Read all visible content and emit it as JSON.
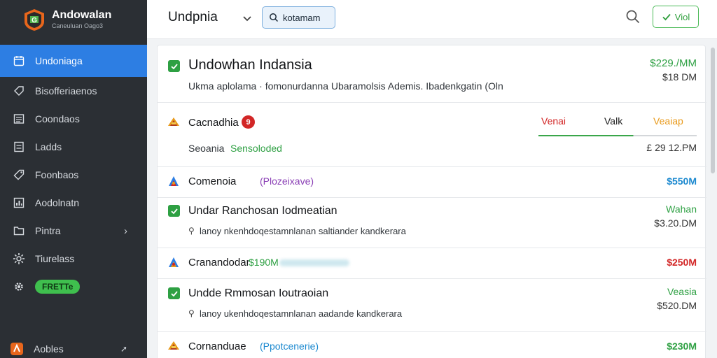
{
  "brand": {
    "title": "Andowalan",
    "subtitle": "Caneuluan Oago3"
  },
  "sidebar": {
    "items": [
      {
        "label": "Undoniaga",
        "icon": "calendar-icon",
        "active": true
      },
      {
        "label": "Bisofferiaenos",
        "icon": "tag-icon"
      },
      {
        "label": "Coondaos",
        "icon": "list-icon"
      },
      {
        "label": "Ladds",
        "icon": "document-icon"
      },
      {
        "label": "Foonbaos",
        "icon": "tag-outline-icon"
      },
      {
        "label": "Aodolnatn",
        "icon": "chart-icon"
      },
      {
        "label": "Pintra",
        "icon": "folder-icon",
        "has_chevron": true
      },
      {
        "label": "Tiurelass",
        "icon": "settings-icon"
      },
      {
        "badge": "FRETTe",
        "icon": "gear-icon"
      }
    ],
    "bottom": {
      "label": "Aobles",
      "icon": "app-icon"
    }
  },
  "topbar": {
    "title": "Undpnia",
    "search_value": "kotamam",
    "button_label": "Viol"
  },
  "rows": [
    {
      "checked": true,
      "title": "Undowhan Indansia",
      "subtitle": "Ukma aplolama · fomonurdanna Ubaramolsis Ademis. Ibadenkgatin (Oln",
      "right_top": "$229./MM",
      "right_bottom": "$18 DM"
    },
    {
      "title": "Cacnadhia",
      "count": "9",
      "subtitle": "Seoania",
      "status": "Sensoloded",
      "tabs": [
        "Venai",
        "Valk",
        "Veaiap"
      ],
      "right_bottom": "£ 29 12.PM"
    },
    {
      "title": "Comenoia",
      "tag": "(Plozeixave)",
      "right_top": "$550M"
    },
    {
      "checked": true,
      "title": "Undar Ranchosan Iodmeatian",
      "subtitle": "lanoy nkenhdoqestamnlanan saltiander kandkerara",
      "right_top": "Wahan",
      "right_bottom": "$3.20.DM"
    },
    {
      "title": "Cranandodar",
      "tag": "$190M",
      "right_top": "$250M"
    },
    {
      "checked": true,
      "title": "Undde Rmmosan Ioutraoian",
      "subtitle": "lanoy ukenhdoqestamnlanan aadande kandkerara",
      "right_top": "Veasia",
      "right_bottom": "$520.DM"
    },
    {
      "title": "Cornanduae",
      "tag": "(Ppotcenerie)",
      "right_top": "$230M"
    }
  ],
  "colors": {
    "accent_blue": "#2d7ee3",
    "accent_green": "#2ea043",
    "red": "#d22626",
    "purple": "#8a3fb5",
    "orange": "#e89a1b",
    "sidebar_bg": "#2b2f34"
  }
}
